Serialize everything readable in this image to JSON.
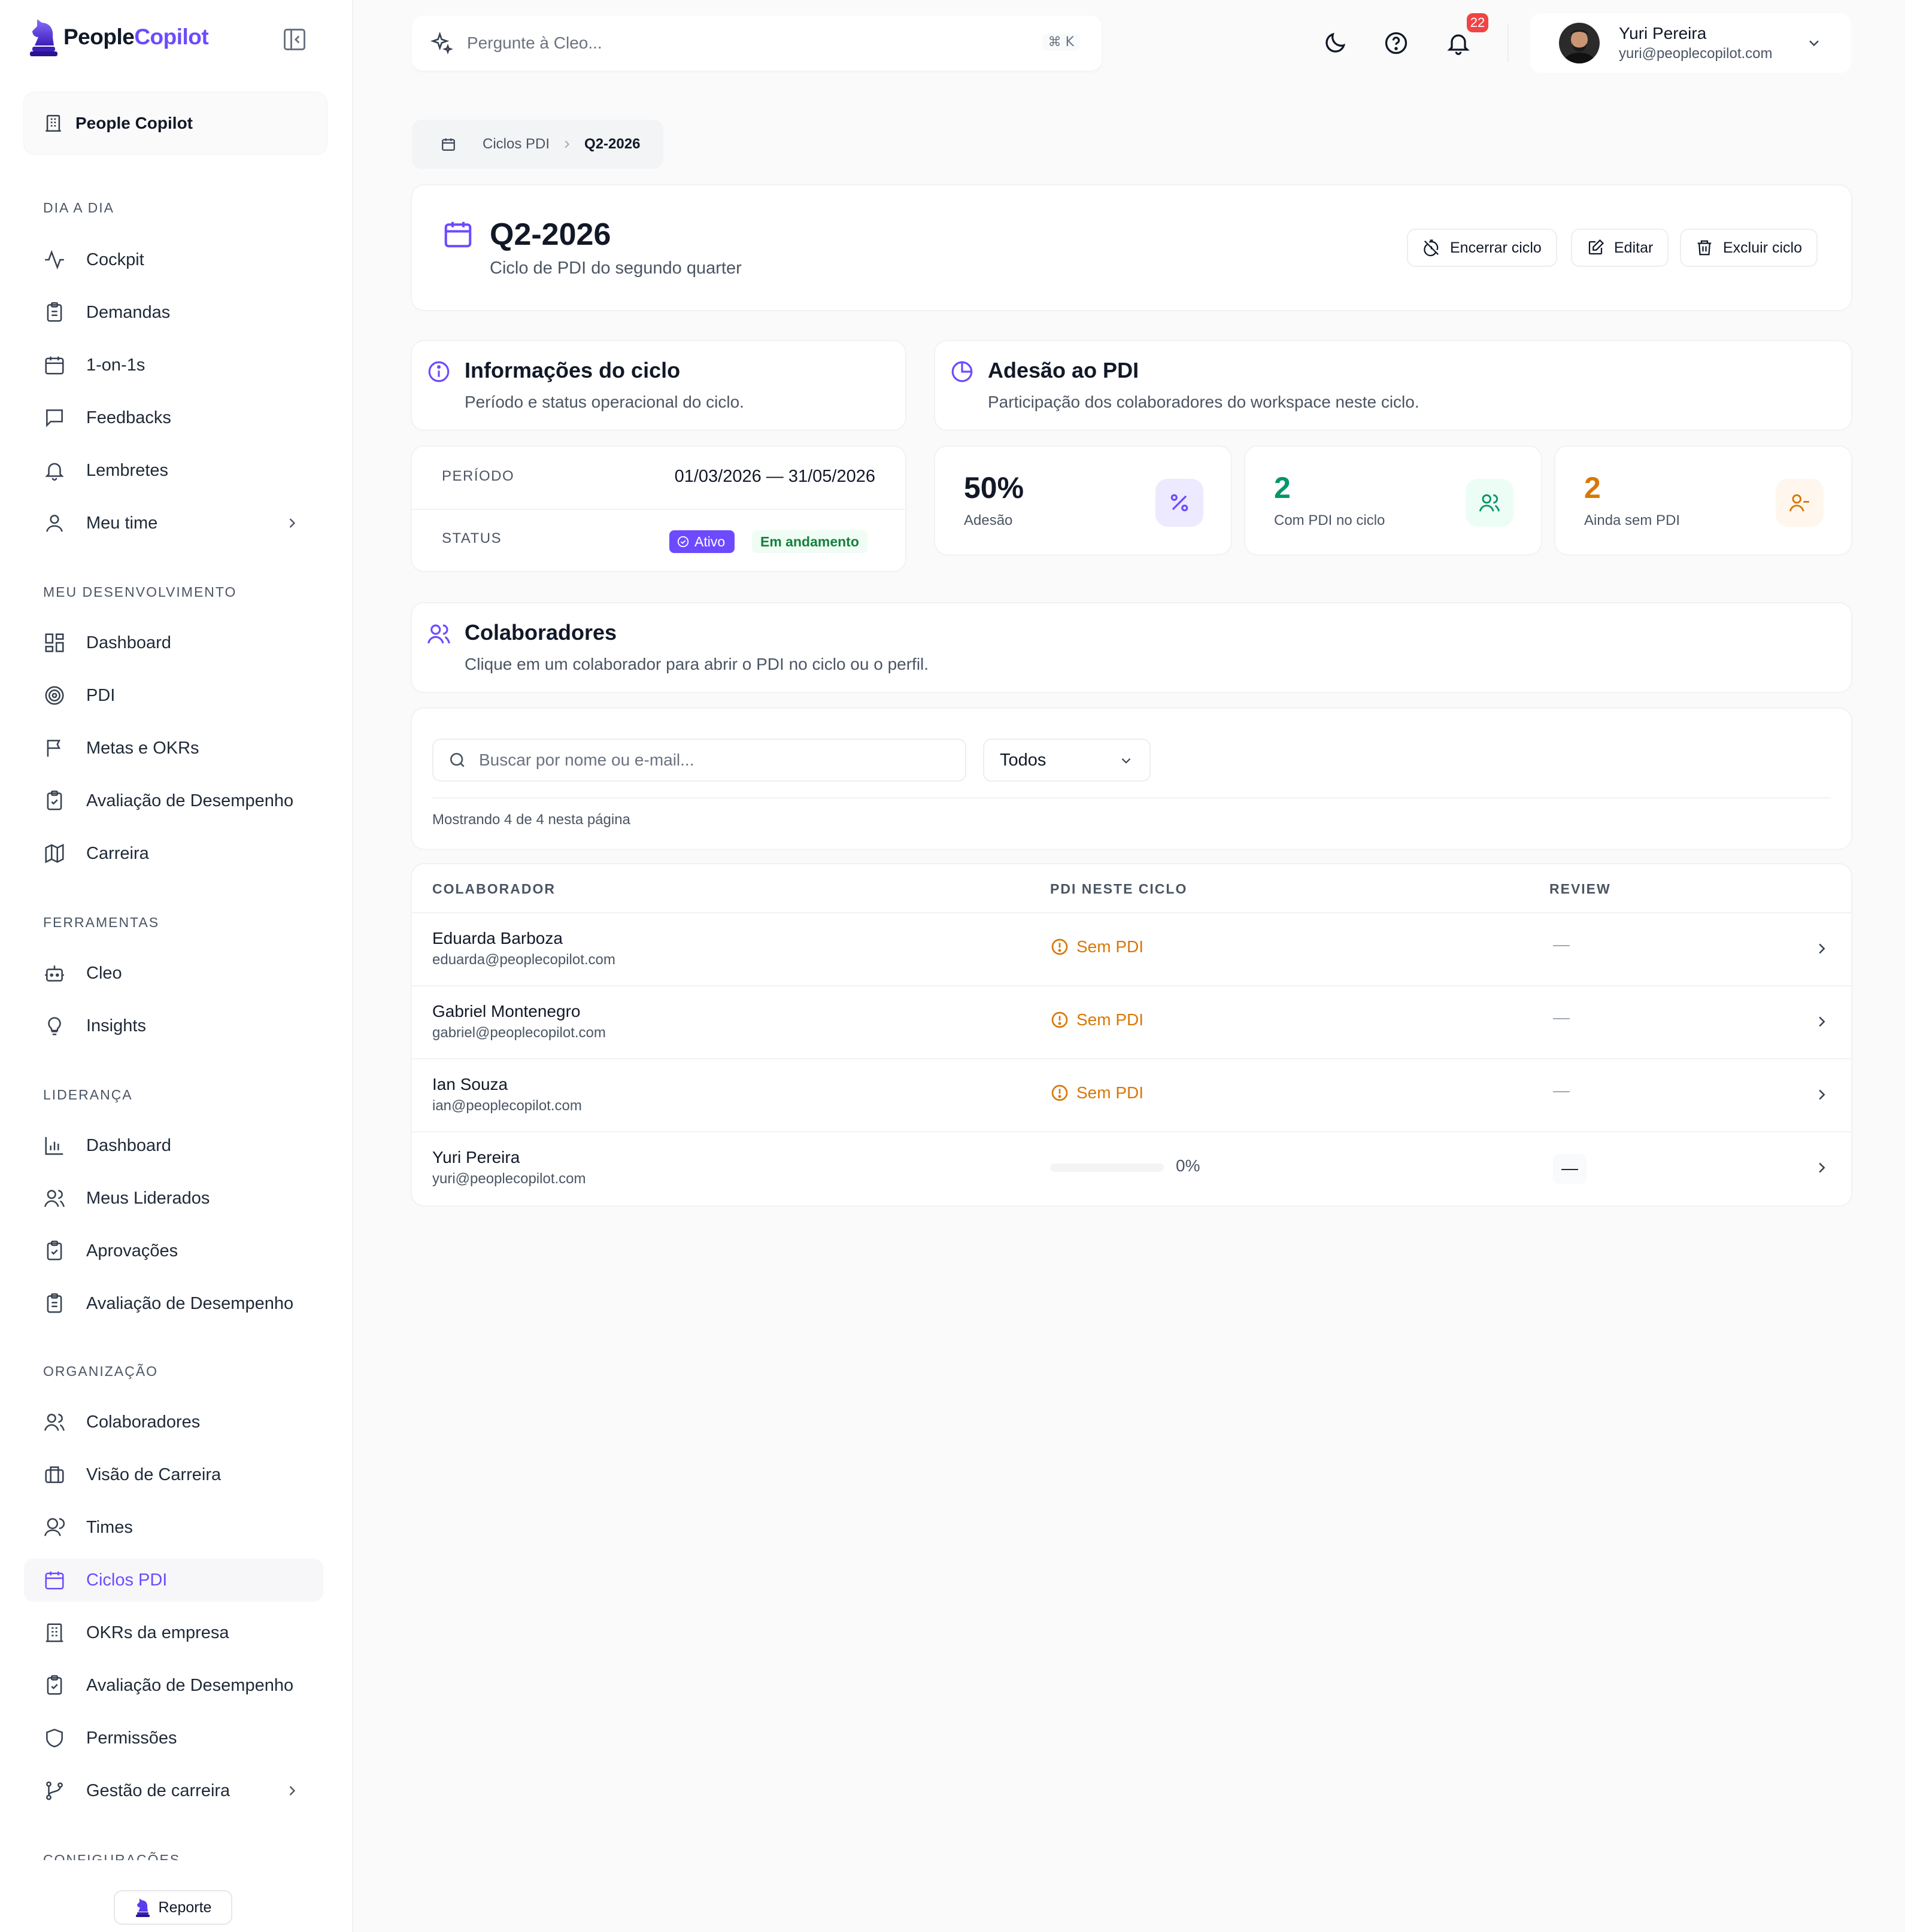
{
  "brand": {
    "name_part1": "People",
    "name_part2": "Copilot",
    "report_label": "Reporte"
  },
  "workspace": {
    "label": "People Copilot"
  },
  "sidebar": {
    "sections": [
      {
        "title": "DIA A DIA",
        "items": [
          {
            "label": "Cockpit",
            "icon": "activity-icon"
          },
          {
            "label": "Demandas",
            "icon": "clipboard-list-icon"
          },
          {
            "label": "1-on-1s",
            "icon": "calendar-icon"
          },
          {
            "label": "Feedbacks",
            "icon": "message-square-icon"
          },
          {
            "label": "Lembretes",
            "icon": "bell-icon"
          },
          {
            "label": "Meu time",
            "icon": "user-icon",
            "has_submenu": true
          }
        ]
      },
      {
        "title": "MEU DESENVOLVIMENTO",
        "items": [
          {
            "label": "Dashboard",
            "icon": "layout-dashboard-icon"
          },
          {
            "label": "PDI",
            "icon": "target-icon"
          },
          {
            "label": "Metas e OKRs",
            "icon": "flag-icon"
          },
          {
            "label": "Avaliação de Desempenho",
            "icon": "clipboard-check-icon"
          },
          {
            "label": "Carreira",
            "icon": "map-icon"
          }
        ]
      },
      {
        "title": "FERRAMENTAS",
        "items": [
          {
            "label": "Cleo",
            "icon": "bot-icon"
          },
          {
            "label": "Insights",
            "icon": "lightbulb-icon"
          }
        ]
      },
      {
        "title": "LIDERANÇA",
        "items": [
          {
            "label": "Dashboard",
            "icon": "bar-chart-icon"
          },
          {
            "label": "Meus Liderados",
            "icon": "users-icon"
          },
          {
            "label": "Aprovações",
            "icon": "clipboard-check-icon"
          },
          {
            "label": "Avaliação de Desempenho",
            "icon": "clipboard-list-icon"
          }
        ]
      },
      {
        "title": "ORGANIZAÇÃO",
        "items": [
          {
            "label": "Colaboradores",
            "icon": "users-icon"
          },
          {
            "label": "Visão de Carreira",
            "icon": "briefcase-icon"
          },
          {
            "label": "Times",
            "icon": "user-group-icon"
          },
          {
            "label": "Ciclos PDI",
            "icon": "calendar-icon",
            "active": true
          },
          {
            "label": "OKRs da empresa",
            "icon": "building-icon"
          },
          {
            "label": "Avaliação de Desempenho",
            "icon": "clipboard-check-icon"
          },
          {
            "label": "Permissões",
            "icon": "shield-icon"
          },
          {
            "label": "Gestão de carreira",
            "icon": "git-branch-icon",
            "has_submenu": true
          }
        ]
      },
      {
        "title": "CONFIGURAÇÕES",
        "items": []
      }
    ]
  },
  "topbar": {
    "ask_placeholder": "Pergunte à Cleo...",
    "shortcut": "⌘ K",
    "notifications_count": "22",
    "user": {
      "name": "Yuri Pereira",
      "email": "yuri@peoplecopilot.com"
    }
  },
  "breadcrumb": {
    "parent": "Ciclos PDI",
    "current": "Q2-2026"
  },
  "cycle": {
    "title": "Q2-2026",
    "subtitle": "Ciclo de PDI do segundo quarter",
    "actions": {
      "close": "Encerrar ciclo",
      "edit": "Editar",
      "delete": "Excluir ciclo"
    }
  },
  "info": {
    "title": "Informações do ciclo",
    "subtitle": "Período e status operacional do ciclo.",
    "period_label": "PERÍODO",
    "period_value": "01/03/2026 — 31/05/2026",
    "status_label": "STATUS",
    "status_badge": "Ativo",
    "status_phase": "Em andamento"
  },
  "adhesion": {
    "title": "Adesão ao PDI",
    "subtitle": "Participação dos colaboradores do workspace neste ciclo.",
    "stats": [
      {
        "value": "50%",
        "label": "Adesão",
        "color": "#111827",
        "icon": "percent-icon"
      },
      {
        "value": "2",
        "label": "Com PDI no ciclo",
        "color": "#059669",
        "icon": "users-icon"
      },
      {
        "value": "2",
        "label": "Ainda sem PDI",
        "color": "#d97706",
        "icon": "user-minus-icon"
      }
    ]
  },
  "collaborators": {
    "title": "Colaboradores",
    "subtitle": "Clique em um colaborador para abrir o PDI no ciclo ou o perfil.",
    "search_placeholder": "Buscar por nome ou e-mail...",
    "filter_value": "Todos",
    "showing": "Mostrando 4 de 4 nesta página",
    "columns": [
      "COLABORADOR",
      "PDI NESTE CICLO",
      "REVIEW"
    ],
    "rows": [
      {
        "name": "Eduarda Barboza",
        "email": "eduarda@peoplecopilot.com",
        "pdi": "Sem PDI",
        "review": "—"
      },
      {
        "name": "Gabriel Montenegro",
        "email": "gabriel@peoplecopilot.com",
        "pdi": "Sem PDI",
        "review": "—"
      },
      {
        "name": "Ian Souza",
        "email": "ian@peoplecopilot.com",
        "pdi": "Sem PDI",
        "review": "—"
      },
      {
        "name": "Yuri Pereira",
        "email": "yuri@peoplecopilot.com",
        "pdi_progress": 0,
        "pdi_progress_label": "0%",
        "review": "—"
      }
    ]
  },
  "colors": {
    "accent": "#6d4aff",
    "success": "#059669",
    "warning": "#d97706",
    "danger": "#ef4444"
  }
}
